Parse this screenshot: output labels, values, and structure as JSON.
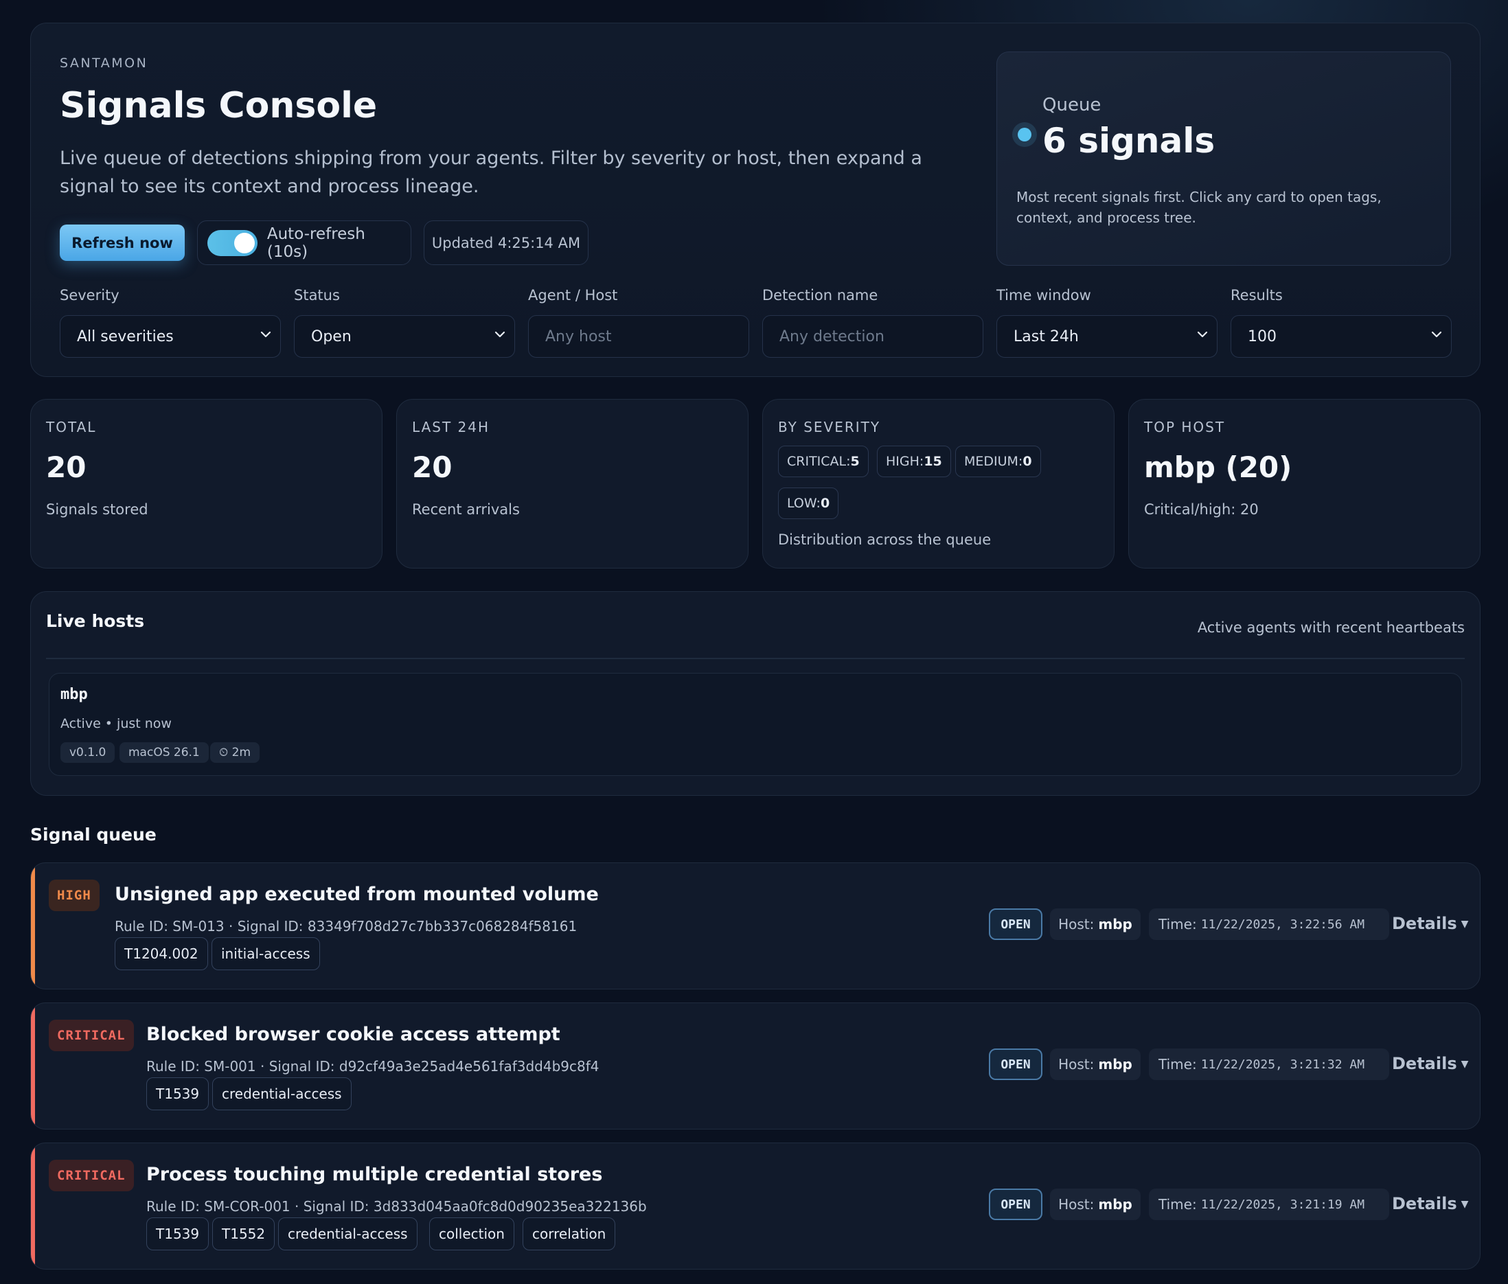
{
  "header": {
    "brand": "SANTAMON",
    "title": "Signals Console",
    "description": "Live queue of detections shipping from your agents. Filter by severity or host, then expand a signal to see its context and process lineage.",
    "refresh_label": "Refresh now",
    "auto_refresh_label": "Auto-refresh (10s)",
    "auto_refresh_on": true,
    "updated_label": "Updated 4:25:14 AM"
  },
  "queue": {
    "label": "Queue",
    "count": "6 signals",
    "description": "Most recent signals first. Click any card to open tags, context, and process tree."
  },
  "filters": {
    "severity": {
      "label": "Severity",
      "value": "All severities"
    },
    "status": {
      "label": "Status",
      "value": "Open"
    },
    "agent": {
      "label": "Agent / Host",
      "placeholder": "Any host"
    },
    "detection": {
      "label": "Detection name",
      "placeholder": "Any detection"
    },
    "time_window": {
      "label": "Time window",
      "value": "Last 24h"
    },
    "results": {
      "label": "Results",
      "value": "100"
    }
  },
  "stats": {
    "total": {
      "label": "TOTAL",
      "value": "20",
      "sub": "Signals stored"
    },
    "last24": {
      "label": "LAST 24H",
      "value": "20",
      "sub": "Recent arrivals"
    },
    "by_severity": {
      "label": "BY SEVERITY",
      "items": [
        {
          "name": "CRITICAL:",
          "count": "5"
        },
        {
          "name": "HIGH:",
          "count": "15"
        },
        {
          "name": "MEDIUM:",
          "count": "0"
        },
        {
          "name": "LOW:",
          "count": "0"
        }
      ],
      "sub": "Distribution across the queue"
    },
    "top_host": {
      "label": "TOP HOST",
      "value": "mbp (20)",
      "sub": "Critical/high: 20"
    }
  },
  "live_hosts": {
    "title": "Live hosts",
    "meta": "Active agents with recent heartbeats",
    "hosts": [
      {
        "name": "mbp",
        "status": "Active • just now",
        "pills": [
          "v0.1.0",
          "macOS 26.1",
          "⏲ 2m"
        ]
      }
    ]
  },
  "signal_queue": {
    "title": "Signal queue",
    "signals": [
      {
        "severity": "HIGH",
        "title": "Unsigned app executed from mounted volume",
        "ids": "Rule ID: SM-013 · Signal ID: 83349f708d27c7bb337c068284f58161",
        "tags": [
          "T1204.002",
          "initial-access"
        ],
        "status": "OPEN",
        "host_label": "Host:",
        "host": "mbp",
        "time_label": "Time:",
        "time": "11/22/2025, 3:22:56 AM",
        "details": "Details"
      },
      {
        "severity": "CRITICAL",
        "title": "Blocked browser cookie access attempt",
        "ids": "Rule ID: SM-001 · Signal ID: d92cf49a3e25ad4e561faf3dd4b9c8f4",
        "tags": [
          "T1539",
          "credential-access"
        ],
        "status": "OPEN",
        "host_label": "Host:",
        "host": "mbp",
        "time_label": "Time:",
        "time": "11/22/2025, 3:21:32 AM",
        "details": "Details"
      },
      {
        "severity": "CRITICAL",
        "title": "Process touching multiple credential stores",
        "ids": "Rule ID: SM-COR-001 · Signal ID: 3d833d045aa0fc8d0d90235ea322136b",
        "tags": [
          "T1539",
          "T1552",
          "credential-access",
          "collection",
          "correlation"
        ],
        "status": "OPEN",
        "host_label": "Host:",
        "host": "mbp",
        "time_label": "Time:",
        "time": "11/22/2025, 3:21:19 AM",
        "details": "Details"
      }
    ]
  },
  "colors": {
    "background": "#0a1120",
    "accent": "#59c3f0",
    "high": "#f08a4a",
    "critical": "#f06a60"
  }
}
